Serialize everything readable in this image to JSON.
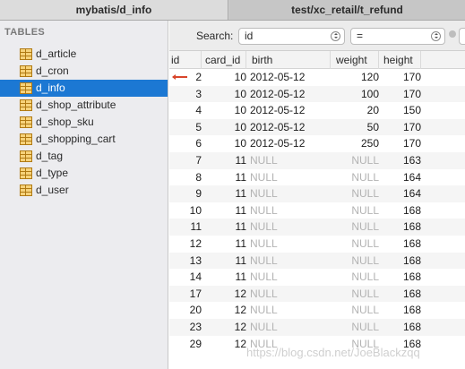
{
  "tabs": [
    {
      "label": "mybatis/d_info",
      "active": true
    },
    {
      "label": "test/xc_retail/t_refund",
      "active": false
    }
  ],
  "sidebar": {
    "header": "TABLES",
    "items": [
      {
        "label": "d_article",
        "selected": false
      },
      {
        "label": "d_cron",
        "selected": false
      },
      {
        "label": "d_info",
        "selected": true
      },
      {
        "label": "d_shop_attribute",
        "selected": false
      },
      {
        "label": "d_shop_sku",
        "selected": false
      },
      {
        "label": "d_shopping_cart",
        "selected": false
      },
      {
        "label": "d_tag",
        "selected": false
      },
      {
        "label": "d_type",
        "selected": false
      },
      {
        "label": "d_user",
        "selected": false
      }
    ]
  },
  "filter": {
    "search_label": "Search:",
    "field_value": "id",
    "operator_value": "="
  },
  "table": {
    "columns": [
      "id",
      "card_id",
      "birth",
      "weight",
      "height"
    ],
    "rows": [
      [
        "2",
        "10",
        "2012-05-12",
        "120",
        "170"
      ],
      [
        "3",
        "10",
        "2012-05-12",
        "100",
        "170"
      ],
      [
        "4",
        "10",
        "2012-05-12",
        "20",
        "150"
      ],
      [
        "5",
        "10",
        "2012-05-12",
        "50",
        "170"
      ],
      [
        "6",
        "10",
        "2012-05-12",
        "250",
        "170"
      ],
      [
        "7",
        "11",
        "NULL",
        "NULL",
        "163"
      ],
      [
        "8",
        "11",
        "NULL",
        "NULL",
        "164"
      ],
      [
        "9",
        "11",
        "NULL",
        "NULL",
        "164"
      ],
      [
        "10",
        "11",
        "NULL",
        "NULL",
        "168"
      ],
      [
        "11",
        "11",
        "NULL",
        "NULL",
        "168"
      ],
      [
        "12",
        "11",
        "NULL",
        "NULL",
        "168"
      ],
      [
        "13",
        "11",
        "NULL",
        "NULL",
        "168"
      ],
      [
        "14",
        "11",
        "NULL",
        "NULL",
        "168"
      ],
      [
        "17",
        "12",
        "NULL",
        "NULL",
        "168"
      ],
      [
        "20",
        "12",
        "NULL",
        "NULL",
        "168"
      ],
      [
        "23",
        "12",
        "NULL",
        "NULL",
        "168"
      ],
      [
        "29",
        "12",
        "NULL",
        "NULL",
        "168"
      ]
    ]
  },
  "watermark": "https://blog.csdn.net/JoeBlackzqq",
  "colors": {
    "selection": "#1c78d3",
    "null_text": "#b3b3b3",
    "row_marker": "#d8452b"
  }
}
